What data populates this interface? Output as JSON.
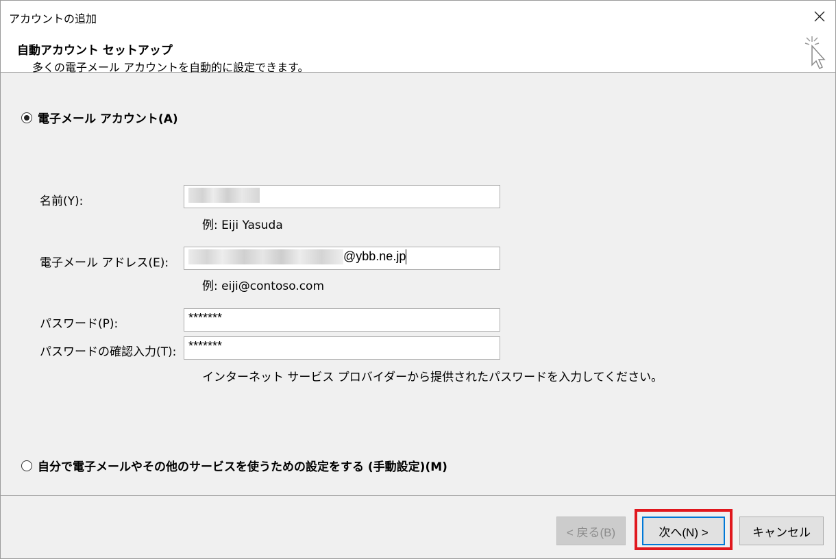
{
  "window": {
    "title": "アカウントの追加"
  },
  "header": {
    "title": "自動アカウント セットアップ",
    "subtitle": "多くの電子メール アカウントを自動的に設定できます。",
    "icon": "wizard-cursor-icon"
  },
  "options": {
    "email_account": {
      "label": "電子メール アカウント(A)",
      "selected": true
    },
    "manual": {
      "label": "自分で電子メールやその他のサービスを使うための設定をする (手動設定)(M)",
      "selected": false
    }
  },
  "form": {
    "name": {
      "label": "名前(Y):",
      "value": "",
      "hint": "例: Eiji Yasuda"
    },
    "email": {
      "label": "電子メール アドレス(E):",
      "value_visible": "@ybb.ne.jp",
      "hint": "例: eiji@contoso.com"
    },
    "password": {
      "label": "パスワード(P):",
      "value": "*******"
    },
    "password_confirm": {
      "label": "パスワードの確認入力(T):",
      "value": "*******"
    },
    "password_hint": "インターネット サービス プロバイダーから提供されたパスワードを入力してください。"
  },
  "buttons": {
    "back": "< 戻る(B)",
    "next": "次へ(N) >",
    "cancel": "キャンセル"
  },
  "colors": {
    "highlight": "#e0181e",
    "focus": "#0078d7"
  }
}
